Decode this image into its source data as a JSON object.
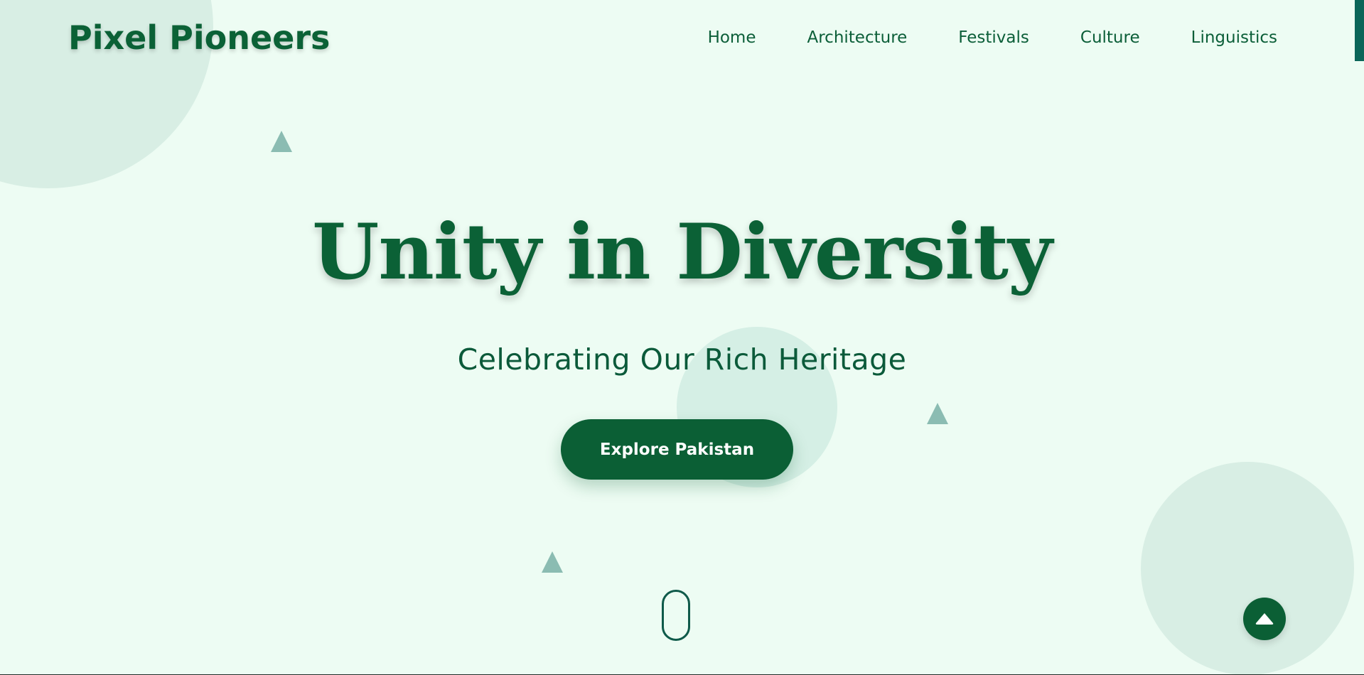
{
  "header": {
    "logo": "Pixel Pioneers",
    "nav": [
      {
        "label": "Home"
      },
      {
        "label": "Architecture"
      },
      {
        "label": "Festivals"
      },
      {
        "label": "Culture"
      },
      {
        "label": "Linguistics"
      }
    ]
  },
  "hero": {
    "title": "Unity in Diversity",
    "subtitle": "Celebrating Our Rich Heritage",
    "cta_label": "Explore Pakistan"
  },
  "icons": {
    "back_to_top": "chevron-up-icon",
    "scroll_indicator": "mouse-scroll-icon"
  },
  "colors": {
    "background": "#edfcf3",
    "primary": "#0b6136",
    "accent_triangle": "#8bbcb2",
    "deco_circle": "#d8eee4",
    "scroll_progress": "#0a6558"
  }
}
